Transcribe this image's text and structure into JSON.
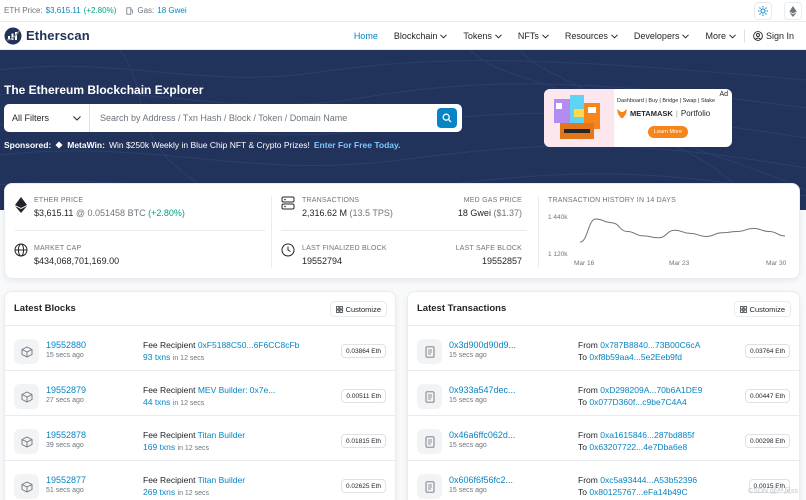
{
  "topbar": {
    "eth_price_label": "ETH Price:",
    "eth_price_value": "$3,615.11",
    "eth_price_change": "(+2.80%)",
    "gas_label": "Gas:",
    "gas_value": "18 Gwei"
  },
  "nav": {
    "logo_text": "Etherscan",
    "items": [
      {
        "label": "Home"
      },
      {
        "label": "Blockchain"
      },
      {
        "label": "Tokens"
      },
      {
        "label": "NFTs"
      },
      {
        "label": "Resources"
      },
      {
        "label": "Developers"
      },
      {
        "label": "More"
      }
    ],
    "sign_in": "Sign In"
  },
  "hero": {
    "title": "The Ethereum Blockchain Explorer",
    "filter_label": "All Filters",
    "search_placeholder": "Search by Address / Txn Hash / Block / Token / Domain Name",
    "sponsored_label": "Sponsored:",
    "sponsor_name": "MetaWin:",
    "sponsor_text": "Win $250k Weekly in Blue Chip NFT & Crypto Prizes!",
    "sponsor_cta": "Enter For Free Today."
  },
  "ad": {
    "tag": "Ad",
    "nav_text": "Dashboard | Buy | Bridge | Swap | Stake",
    "brand": "METAMASK",
    "product": "Portfolio",
    "button": "Learn More"
  },
  "stats": {
    "ether_price_label": "ETHER PRICE",
    "ether_price_value": "$3,615.11",
    "ether_price_btc": "@ 0.051458 BTC",
    "ether_price_change": "(+2.80%)",
    "market_cap_label": "MARKET CAP",
    "market_cap_value": "$434,068,701,169.00",
    "transactions_label": "TRANSACTIONS",
    "transactions_value": "2,316.62 M",
    "transactions_tps": "(13.5 TPS)",
    "med_gas_label": "MED GAS PRICE",
    "med_gas_value": "18 Gwei",
    "med_gas_usd": "($1.37)",
    "finalized_label": "LAST FINALIZED BLOCK",
    "finalized_value": "19552794",
    "safe_label": "LAST SAFE BLOCK",
    "safe_value": "19552857"
  },
  "chart_data": {
    "type": "line",
    "title": "TRANSACTION HISTORY IN 14 DAYS",
    "x": [
      "Mar 17",
      "Mar 18",
      "Mar 19",
      "Mar 20",
      "Mar 21",
      "Mar 22",
      "Mar 23",
      "Mar 24",
      "Mar 25",
      "Mar 26",
      "Mar 27",
      "Mar 28",
      "Mar 29",
      "Mar 30"
    ],
    "values": [
      1.215,
      1.4,
      1.37,
      1.3,
      1.265,
      1.25,
      1.31,
      1.285,
      1.26,
      1.29,
      1.3,
      1.325,
      1.3,
      1.265
    ],
    "ytick_labels": [
      "1 440k",
      "1 120k"
    ],
    "yticks": [
      1.44,
      1.12
    ],
    "ylim": [
      1.12,
      1.44
    ],
    "xtick_labels": [
      "Mar 16",
      "Mar 23",
      "Mar 30"
    ],
    "xticks": [
      16,
      23,
      30
    ],
    "xlim": [
      16,
      30
    ],
    "color": "#6c757d",
    "grid": false
  },
  "blocks": {
    "title": "Latest Blocks",
    "customize": "Customize",
    "rows": [
      {
        "number": "19552880",
        "age": "15 secs ago",
        "recipient_label": "Fee Recipient",
        "recipient": "0xF5188C50...6F6CC8cFb",
        "txns": "93 txns",
        "txns_time": "in 12 secs",
        "reward": "0.03864 Eth"
      },
      {
        "number": "19552879",
        "age": "27 secs ago",
        "recipient_label": "Fee Recipient",
        "recipient": "MEV Builder: 0x7e...",
        "txns": "44 txns",
        "txns_time": "in 12 secs",
        "reward": "0.00511 Eth"
      },
      {
        "number": "19552878",
        "age": "39 secs ago",
        "recipient_label": "Fee Recipient",
        "recipient": "Titan Builder",
        "txns": "169 txns",
        "txns_time": "in 12 secs",
        "reward": "0.01815 Eth"
      },
      {
        "number": "19552877",
        "age": "51 secs ago",
        "recipient_label": "Fee Recipient",
        "recipient": "Titan Builder",
        "txns": "269 txns",
        "txns_time": "in 12 secs",
        "reward": "0.02625 Eth"
      }
    ]
  },
  "transactions": {
    "title": "Latest Transactions",
    "customize": "Customize",
    "rows": [
      {
        "hash": "0x3d900d90d9...",
        "age": "15 secs ago",
        "from_label": "From",
        "from": "0x787B8840...73B00C6cA",
        "to_label": "To",
        "to": "0xf8b59aa4...5e2Eeb9fd",
        "value": "0.03764 Eth"
      },
      {
        "hash": "0x933a547dec...",
        "age": "15 secs ago",
        "from_label": "From",
        "from": "0xD298209A...70b6A1DE9",
        "to_label": "To",
        "to": "0x077D360f...c9be7C4A4",
        "value": "0.00447 Eth"
      },
      {
        "hash": "0x46a6ffc062d...",
        "age": "15 secs ago",
        "from_label": "From",
        "from": "0xa1615846...287bd885f",
        "to_label": "To",
        "to": "0x63207722...4e7Dba6e8",
        "value": "0.00298 Eth"
      },
      {
        "hash": "0x606f6f56fc2...",
        "age": "15 secs ago",
        "from_label": "From",
        "from": "0xc5a93444...A53b52396",
        "to_label": "To",
        "to": "0x80125767...eFa14b49C",
        "value": "0.0015 Eth"
      }
    ]
  },
  "watermark": "CSDN @严风ss",
  "colors": {
    "brand_blue": "#0784c3",
    "hero_bg": "#21325b",
    "positive": "#00a186"
  }
}
